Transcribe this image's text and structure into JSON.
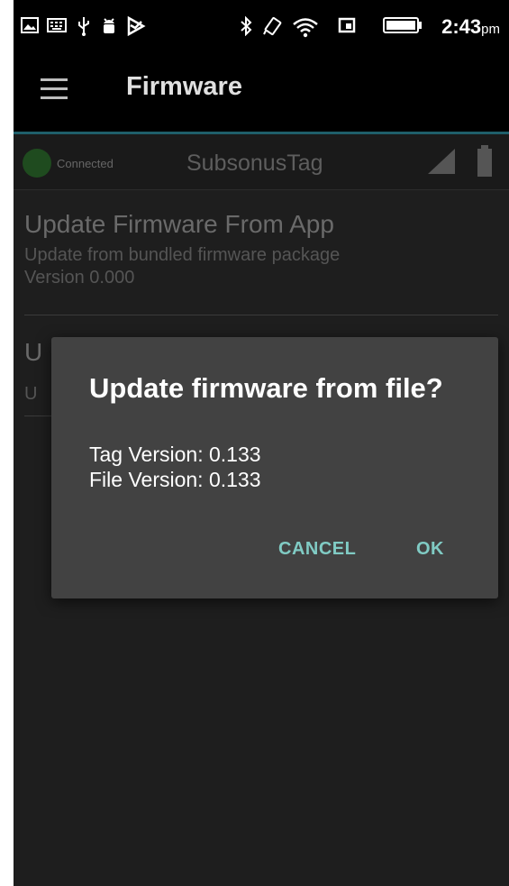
{
  "status_bar": {
    "time": "2:43",
    "time_suffix": "pm",
    "left_icons": [
      "gallery-notification-icon",
      "keyboard-icon",
      "usb-icon",
      "android-debug-icon",
      "play-store-icon"
    ],
    "right_icons": [
      "bluetooth-icon",
      "vibrate-icon",
      "wifi-icon",
      "sim-icon",
      "battery-icon"
    ]
  },
  "app_bar": {
    "title": "Firmware",
    "menu_icon": "hamburger-menu-icon"
  },
  "device": {
    "status": "Connected",
    "name": "SubsonusTag",
    "status_color": "#2e7d32"
  },
  "items": [
    {
      "title": "Update Firmware From App",
      "subtitle": "Update from bundled firmware package",
      "version": "Version 0.000"
    },
    {
      "title": "U",
      "subtitle": "U"
    }
  ],
  "dialog": {
    "title": "Update firmware from file?",
    "tag_version": "Tag Version: 0.133",
    "file_version": "File Version: 0.133",
    "cancel_label": "CANCEL",
    "ok_label": "OK",
    "accent_color": "#80cbc4"
  }
}
